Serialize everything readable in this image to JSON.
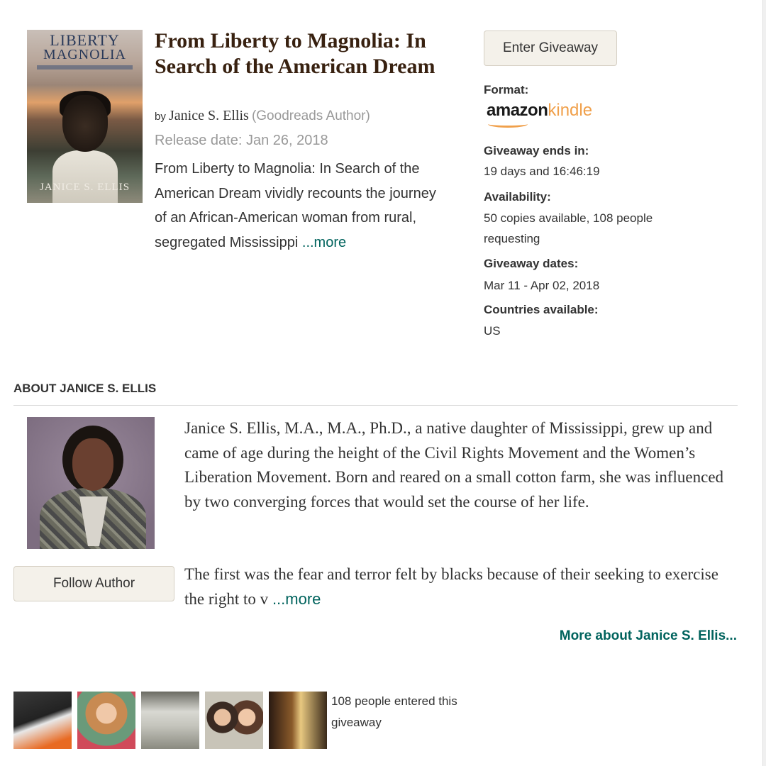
{
  "book": {
    "cover_title_line1": "LIBERTY",
    "cover_title_line2": "MAGNOLIA",
    "cover_author": "JANICE S. ELLIS",
    "title": "From Liberty to Magnolia: In Search of the American Dream",
    "by": "by",
    "author": "Janice S. Ellis",
    "author_tag": "(Goodreads Author)",
    "release": "Release date: Jan 26, 2018",
    "description": "From Liberty to Magnolia: In Search of the American Dream vividly recounts the journey of an African-American woman from rural, segregated Mississippi",
    "more": "...more"
  },
  "giveaway": {
    "enter_label": "Enter Giveaway",
    "format_label": "Format:",
    "format_logo_amazon": "amazon",
    "format_logo_kindle": "kindle",
    "ends_label": "Giveaway ends in:",
    "ends_value": "19 days and 16:46:19",
    "availability_label": "Availability:",
    "availability_value": "50 copies available, 108 people requesting",
    "dates_label": "Giveaway dates:",
    "dates_value": "Mar 11 - Apr 02, 2018",
    "countries_label": "Countries available:",
    "countries_value": "US"
  },
  "about": {
    "heading": "ABOUT JANICE S. ELLIS",
    "bio_p1": "Janice S. Ellis, M.A., M.A., Ph.D., a native daughter of Mississippi, grew up and came of age during the height of the Civil Rights Movement and the Women’s Liberation Movement. Born and reared on a small cotton farm, she was influenced by two converging forces that would set the course of her life.",
    "bio_p2": "The first was the fear and terror felt by blacks because of their seeking to exercise the right to v",
    "more": "...more",
    "follow_label": "Follow Author",
    "more_about": "More about Janice S. Ellis..."
  },
  "entrants": {
    "count_text": "108 people entered this giveaway"
  }
}
